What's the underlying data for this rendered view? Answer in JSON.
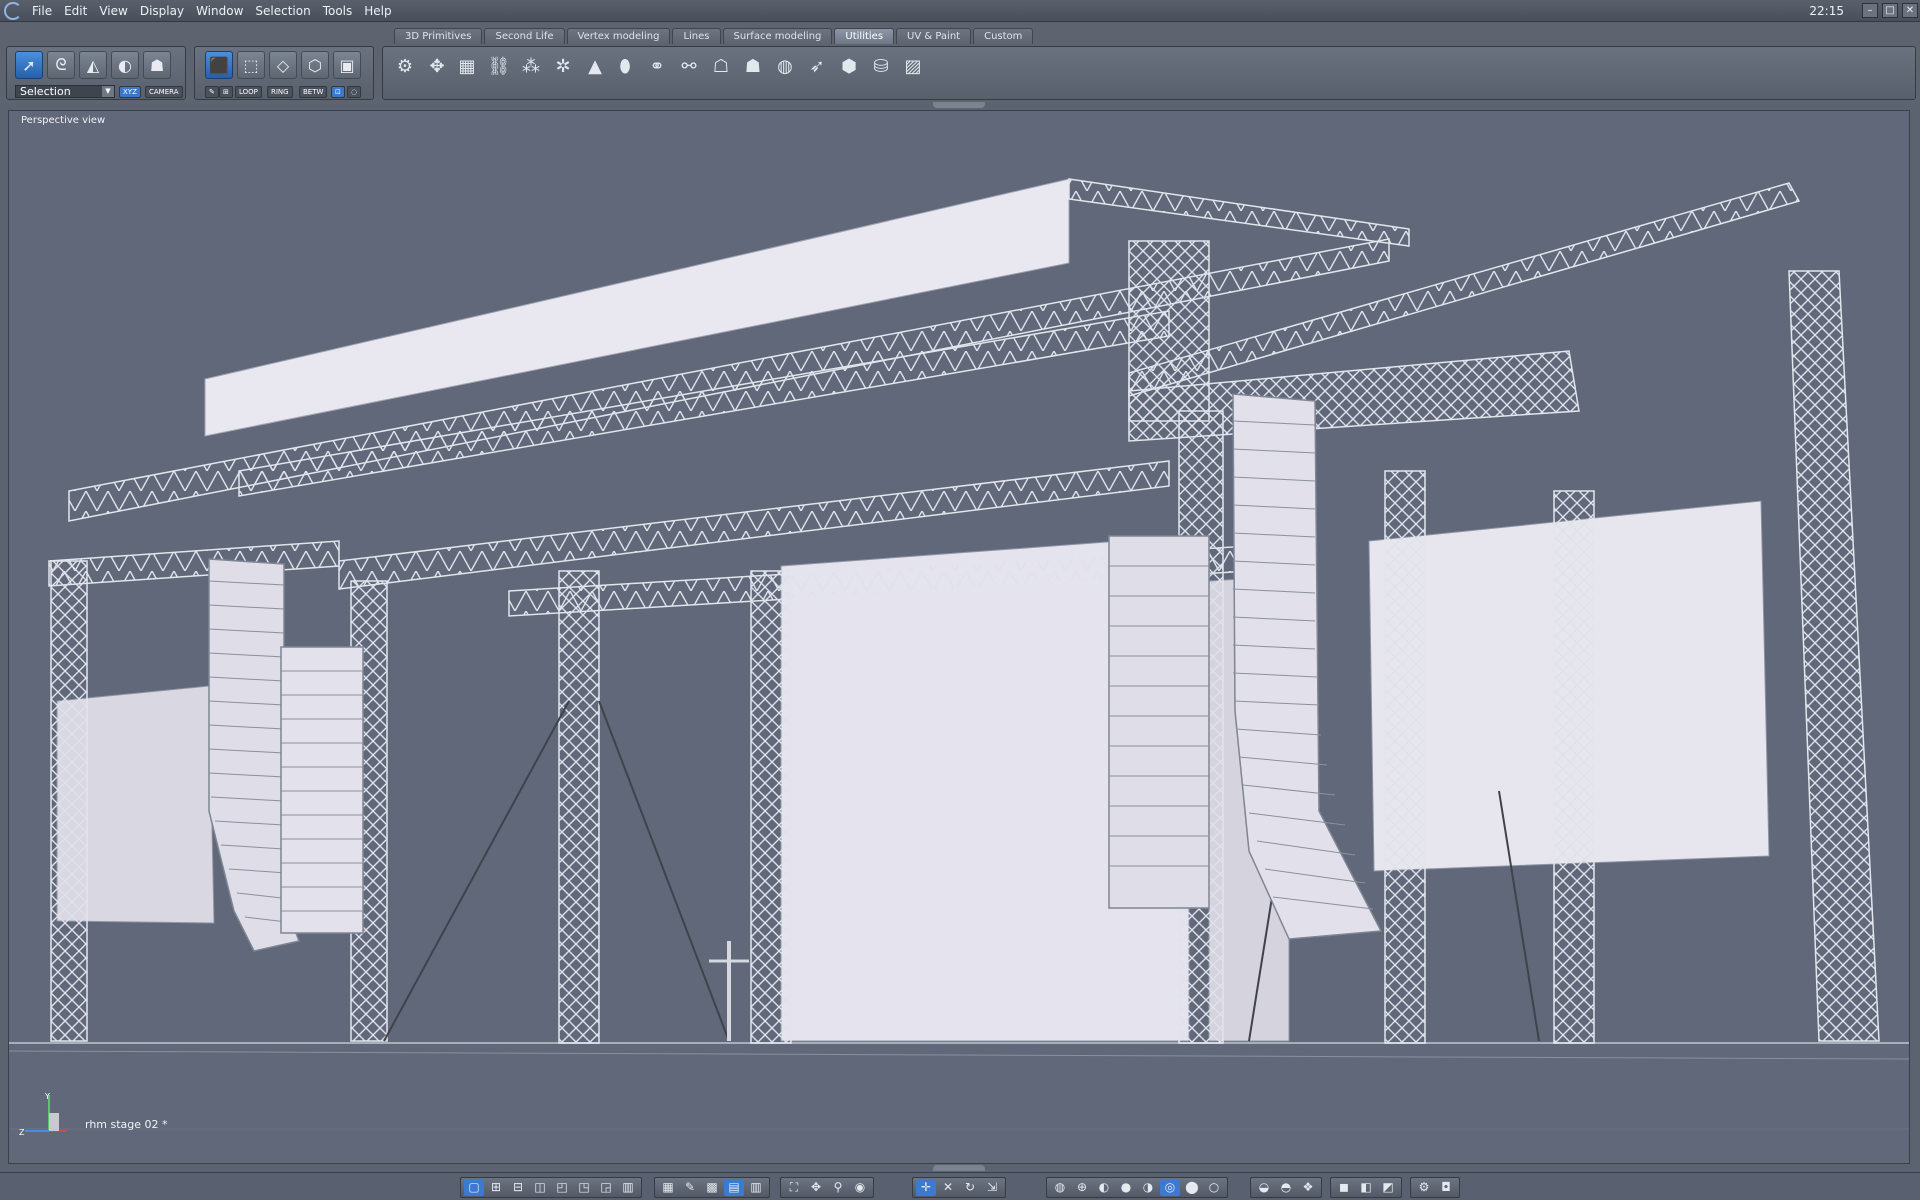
{
  "menubar": {
    "items": [
      "File",
      "Edit",
      "View",
      "Display",
      "Window",
      "Selection",
      "Tools",
      "Help"
    ],
    "clock": "22:15"
  },
  "tabs": [
    {
      "label": "3D Primitives",
      "active": false
    },
    {
      "label": "Second Life",
      "active": false
    },
    {
      "label": "Vertex modeling",
      "active": false
    },
    {
      "label": "Lines",
      "active": false
    },
    {
      "label": "Surface modeling",
      "active": false
    },
    {
      "label": "Utilities",
      "active": true
    },
    {
      "label": "UV & Paint",
      "active": false
    },
    {
      "label": "Custom",
      "active": false
    }
  ],
  "selection_panel": {
    "mode_value": "Selection",
    "xyz_label": "XYZ",
    "camera_label": "CAMERA",
    "tools": [
      "arrow-select-icon",
      "lasso-select-icon",
      "paint-select-icon",
      "ellipse-select-icon",
      "ghost-select-icon"
    ]
  },
  "mesh_panel": {
    "tools": [
      "cube-solid-icon",
      "cube-face-icon",
      "cube-edge-icon",
      "cube-vertex-icon",
      "cube-object-icon"
    ],
    "loop_label": "LOOP",
    "ring_label": "RING",
    "betw_label": "BETW"
  },
  "utilities_tools": [
    "weld-icon",
    "explode-icon",
    "box-icon",
    "chain-icon",
    "cluster-icon",
    "cluster-multi-icon",
    "cone-icon",
    "capsule-icon",
    "link-icon",
    "link-broken-icon",
    "ghost-icon",
    "ghost-outline-icon",
    "sphere-wire-icon",
    "pointer-icon",
    "polygon-icon",
    "cylinder-icon",
    "grid-mesh-icon"
  ],
  "viewport": {
    "view_label": "Perspective view",
    "file_label": "rhm stage 02 *",
    "axis": {
      "y": "Y",
      "z": "Z"
    }
  },
  "bottombar": {
    "layout_icons": [
      "layout-single-icon",
      "layout-quad-icon",
      "layout-two-h-icon",
      "layout-two-v-icon",
      "layout-three-a-icon",
      "layout-three-b-icon",
      "layout-three-c-icon",
      "layout-four-icon"
    ],
    "grid_icons": [
      "grid-icon",
      "paint-icon",
      "color-grid-icon",
      "blue-grid-icon",
      "table-icon"
    ],
    "nav_icons": [
      "fit-icon",
      "pan-icon",
      "zoom-icon",
      "eye-icon"
    ],
    "transform_icons": [
      "select-transform-icon",
      "move-icon",
      "rotate-icon",
      "scale-icon"
    ],
    "shading_icons": [
      "wire-globe-icon",
      "wire-sphere-icon",
      "flat-sphere-icon",
      "smooth-sphere-icon",
      "shaded-sphere-icon",
      "textured-sphere-icon",
      "matte-sphere-icon",
      "white-sphere-icon"
    ],
    "render_icons": [
      "render-a-icon",
      "render-b-icon",
      "render-c-icon"
    ],
    "object_icons": [
      "cube-obj-icon",
      "cubes-obj-icon",
      "group-obj-icon"
    ],
    "camera_icons": [
      "camera-settings-icon",
      "camera-icon"
    ]
  },
  "colors": {
    "accent": "#3b7ad0",
    "background": "#5c6370",
    "viewport": "#60687a"
  }
}
